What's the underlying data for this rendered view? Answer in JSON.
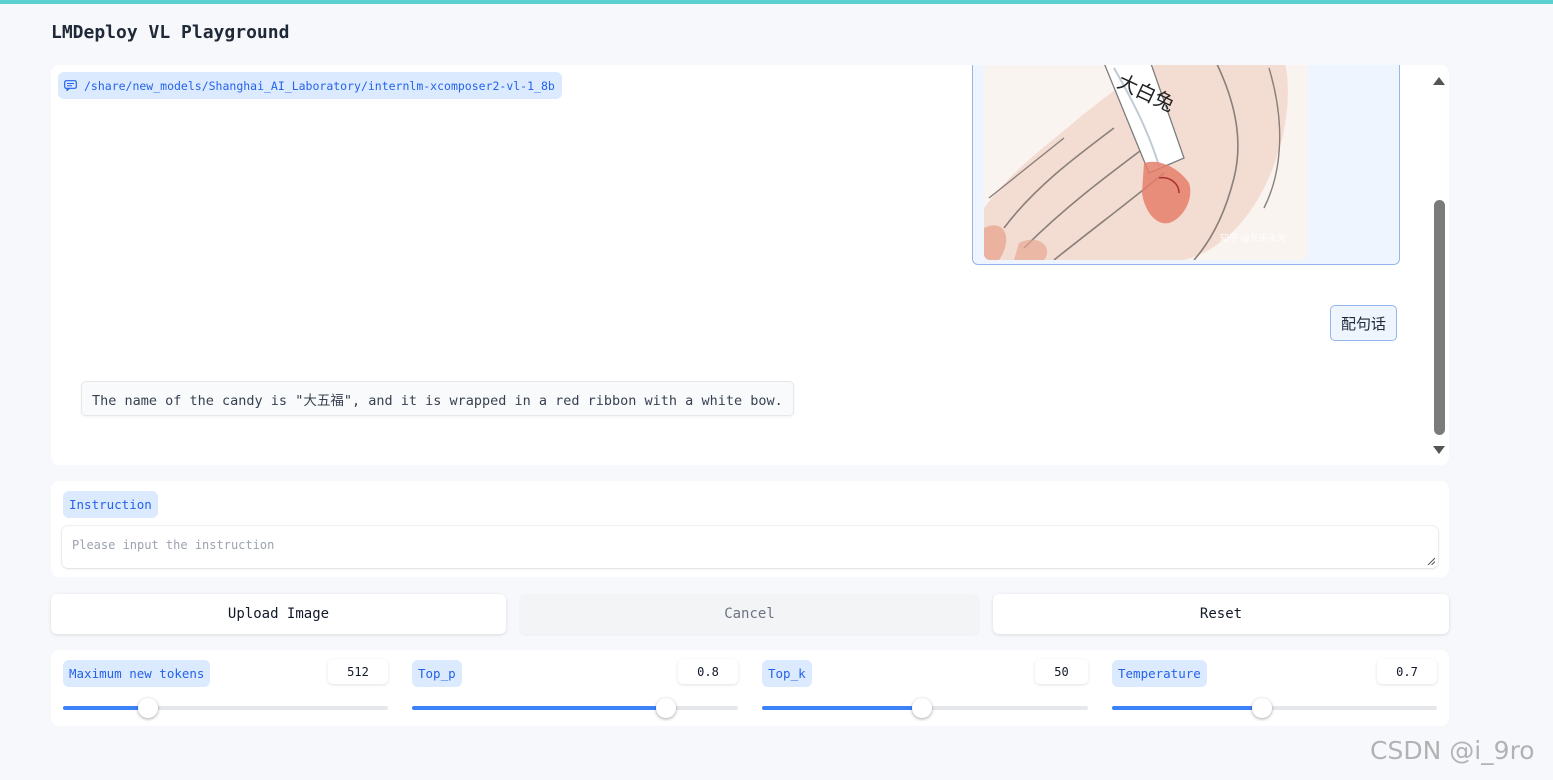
{
  "app": {
    "title": "LMDeploy VL Playground"
  },
  "chat": {
    "label": "/share/new_models/Shanghai_AI_Laboratory/internlm-xcomposer2-vl-1_8b",
    "image": {
      "wrapper_text": "大白兔",
      "watermark_text": "知乎 @长乐未央"
    },
    "user_message": "配句话",
    "bot_message": "The name of the candy is \"大五福\", and it is wrapped in a red ribbon with a white bow."
  },
  "instruction": {
    "label": "Instruction",
    "placeholder": "Please input the instruction",
    "value": ""
  },
  "buttons": {
    "upload": "Upload Image",
    "cancel": "Cancel",
    "reset": "Reset"
  },
  "sliders": [
    {
      "label": "Maximum new tokens",
      "value": "512",
      "fraction": 0.26
    },
    {
      "label": "Top_p",
      "value": "0.8",
      "fraction": 0.78
    },
    {
      "label": "Top_k",
      "value": "50",
      "fraction": 0.49
    },
    {
      "label": "Temperature",
      "value": "0.7",
      "fraction": 0.46
    }
  ],
  "overlay": {
    "watermark": "CSDN @i_9ro"
  },
  "colors": {
    "accent": "#3b82f6",
    "label_bg": "#dbeafe",
    "label_text": "#2563eb",
    "top_bar": "#5ccfd0"
  }
}
